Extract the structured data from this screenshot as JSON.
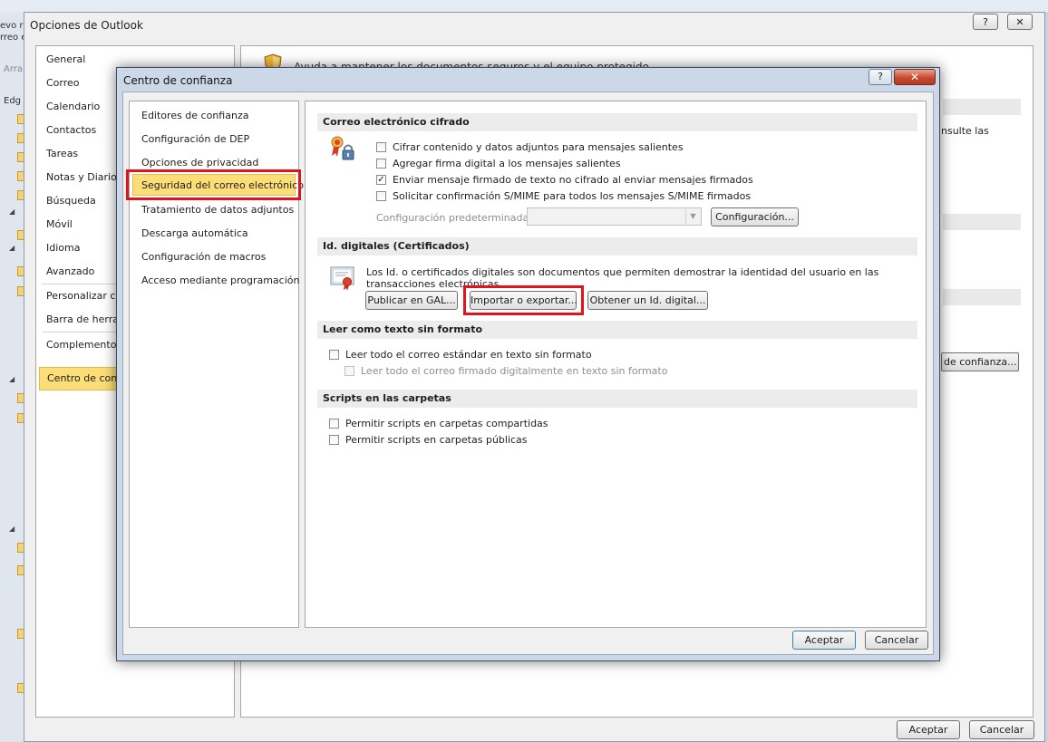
{
  "window": {
    "title": "Opciones de Outlook",
    "help_glyph": "?",
    "close_glyph": "✕"
  },
  "background": {
    "left_labels": [
      "evo r",
      "rreo e",
      "Arra",
      "Edg"
    ]
  },
  "outlook_options": {
    "nav": [
      "General",
      "Correo",
      "Calendario",
      "Contactos",
      "Tareas",
      "Notas y Diario",
      "Búsqueda",
      "Móvil",
      "Idioma",
      "Avanzado",
      "Personalizar cin",
      "Barra de herram",
      "Complementos",
      "Centro de confi"
    ],
    "help_text": "Ayuda a mantener los documentos seguros y el equipo protegido.",
    "consult_text": "nsulte las",
    "trust_center_settings_button": "de confianza...",
    "ok_button": "Aceptar",
    "cancel_button": "Cancelar"
  },
  "trust_center": {
    "title": "Centro de confianza",
    "help_glyph": "?",
    "close_glyph": "✕",
    "nav": [
      "Editores de confianza",
      "Configuración de DEP",
      "Opciones de privacidad",
      "Seguridad del correo electrónico",
      "Tratamiento de datos adjuntos",
      "Descarga automática",
      "Configuración de macros",
      "Acceso mediante programación"
    ],
    "selected_nav": "Seguridad del correo electrónico",
    "sections": {
      "encrypted": {
        "header": "Correo electrónico cifrado",
        "options": [
          {
            "label": "Cifrar contenido y datos adjuntos para mensajes salientes",
            "checked": false
          },
          {
            "label": "Agregar firma digital a los mensajes salientes",
            "checked": false
          },
          {
            "label": "Enviar mensaje firmado de texto no cifrado al enviar mensajes firmados",
            "checked": true
          },
          {
            "label": "Solicitar confirmación S/MIME para todos los mensajes S/MIME firmados",
            "checked": false
          }
        ],
        "default_config_label": "Configuración predeterminada:",
        "default_config_value": "",
        "config_button": "Configuración..."
      },
      "digital_ids": {
        "header": "Id. digitales (Certificados)",
        "description": "Los Id. o certificados digitales son documentos que permiten demostrar la identidad del usuario en las transacciones electrónicas.",
        "publish_button": "Publicar en GAL...",
        "import_export_button": "Importar o exportar...",
        "get_id_button": "Obtener un Id. digital..."
      },
      "plain_text": {
        "header": "Leer como texto sin formato",
        "options": [
          {
            "label": "Leer todo el correo estándar en texto sin formato",
            "checked": false
          },
          {
            "label": "Leer todo el correo firmado digitalmente en texto sin formato",
            "checked": false,
            "disabled": true
          }
        ]
      },
      "scripts": {
        "header": "Scripts en las carpetas",
        "options": [
          {
            "label": "Permitir scripts en carpetas compartidas",
            "checked": false
          },
          {
            "label": "Permitir scripts en carpetas públicas",
            "checked": false
          }
        ]
      }
    },
    "ok_button": "Aceptar",
    "cancel_button": "Cancelar"
  },
  "colors": {
    "selection": "#fcde78",
    "highlight_box": "#e0141e",
    "dialog_frame": "#ccd8e8"
  }
}
